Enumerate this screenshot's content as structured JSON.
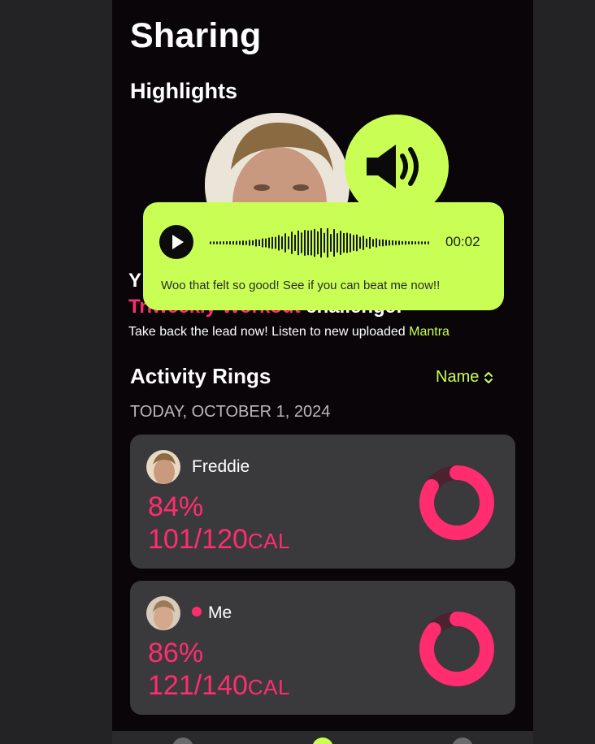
{
  "header": {
    "title": "Sharing"
  },
  "highlights": {
    "section_title": "Highlights",
    "line1": "Y",
    "line2_pink": "Triweekly Workout",
    "line2_white": " challenge!",
    "desc_prefix": "Take back the lead now! Listen to new uploaded ",
    "desc_link": "Mantra",
    "voice_message": {
      "duration": "00:02",
      "text": "Woo that felt so good! See if you can beat me now!!"
    }
  },
  "activity": {
    "section_title": "Activity Rings",
    "sort_label": "Name",
    "date": "TODAY, OCTOBER 1, 2024",
    "cards": [
      {
        "name": "Freddie",
        "percent": "84%",
        "cal_value": "101/120",
        "cal_unit": "CAL",
        "progress": 0.84,
        "is_me": false
      },
      {
        "name": "Me",
        "percent": "86%",
        "cal_value": "121/140",
        "cal_unit": "CAL",
        "progress": 0.86,
        "is_me": true
      }
    ]
  },
  "colors": {
    "accent": "#c9ff55",
    "ring": "#ff2d6f",
    "card": "#3a3a3c"
  },
  "icons": {
    "speaker": "speaker-icon",
    "play": "play-icon",
    "sort": "chevron-up-down-icon"
  }
}
